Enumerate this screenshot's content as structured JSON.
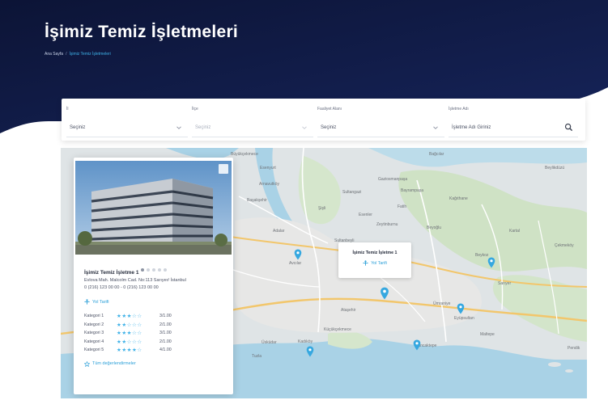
{
  "header": {
    "title": "İşimiz Temiz İşletmeleri",
    "breadcrumb": [
      "Ana Sayfa",
      "İşimiz Temiz İşletmeleri"
    ]
  },
  "filters": [
    {
      "label": "İl",
      "value": "Seçiniz",
      "disabled": false,
      "icon": "chevron-down-icon"
    },
    {
      "label": "İlçe",
      "value": "Seçiniz",
      "disabled": true,
      "icon": "chevron-down-icon"
    },
    {
      "label": "Faaliyet Alanı",
      "value": "Seçiniz",
      "disabled": false,
      "icon": "chevron-down-icon"
    },
    {
      "label": "İşletme Adı",
      "placeholder": "İşletme Adı Giriniz",
      "icon": "search-icon"
    }
  ],
  "map": {
    "place_labels": [
      "Büyükçekmece",
      "Esenyurt",
      "Bağcılar",
      "Beylikdüzü",
      "Avcılar",
      "Küçükçekmece",
      "Eyüpsultan",
      "Sarıyer",
      "Beykoz",
      "Üsküdar",
      "Kadıköy",
      "Ataşehir",
      "Ümraniye",
      "Sancaktepe",
      "Maltepe",
      "Kartal",
      "Çekmeköy",
      "Pendik",
      "Tuzla",
      "Sultanbeyli",
      "Adalar",
      "Zeytinburnu",
      "Fatih",
      "Beyoğlu",
      "Şişli",
      "Sultangazi",
      "Başakşehir",
      "Arnavutköy",
      "Esenler",
      "Bayrampaşa",
      "Gaziosmanpaşa",
      "Kağıthane"
    ],
    "bubble": {
      "name": "İşimiz Temiz İşletme 1",
      "link": "Yol Tarifi"
    },
    "card": {
      "name": "İşimiz Temiz İşletme 1",
      "address": "Evlova Mah. Malcolm Cad. No:113 Sarıyer/ İstanbul",
      "phone": "0 (216) 123 00 00 - 0 (216) 123 00 00",
      "directions": "Yol Tarifi",
      "close_icon": "close-icon",
      "ratings": [
        {
          "category": "Kategori 1",
          "stars": 3,
          "score": "3/1.00"
        },
        {
          "category": "Kategori 2",
          "stars": 2,
          "score": "2/1.00"
        },
        {
          "category": "Kategori 3",
          "stars": 3,
          "score": "3/1.00"
        },
        {
          "category": "Kategori 4",
          "stars": 2,
          "score": "2/1.00"
        },
        {
          "category": "Kategori 5",
          "stars": 4,
          "score": "4/1.00"
        }
      ],
      "all_reviews": "Tüm değerlendirmeler"
    }
  },
  "colors": {
    "hero": "#0f1a3d",
    "accent": "#2a9fd8",
    "pin": "#36a8e0"
  }
}
